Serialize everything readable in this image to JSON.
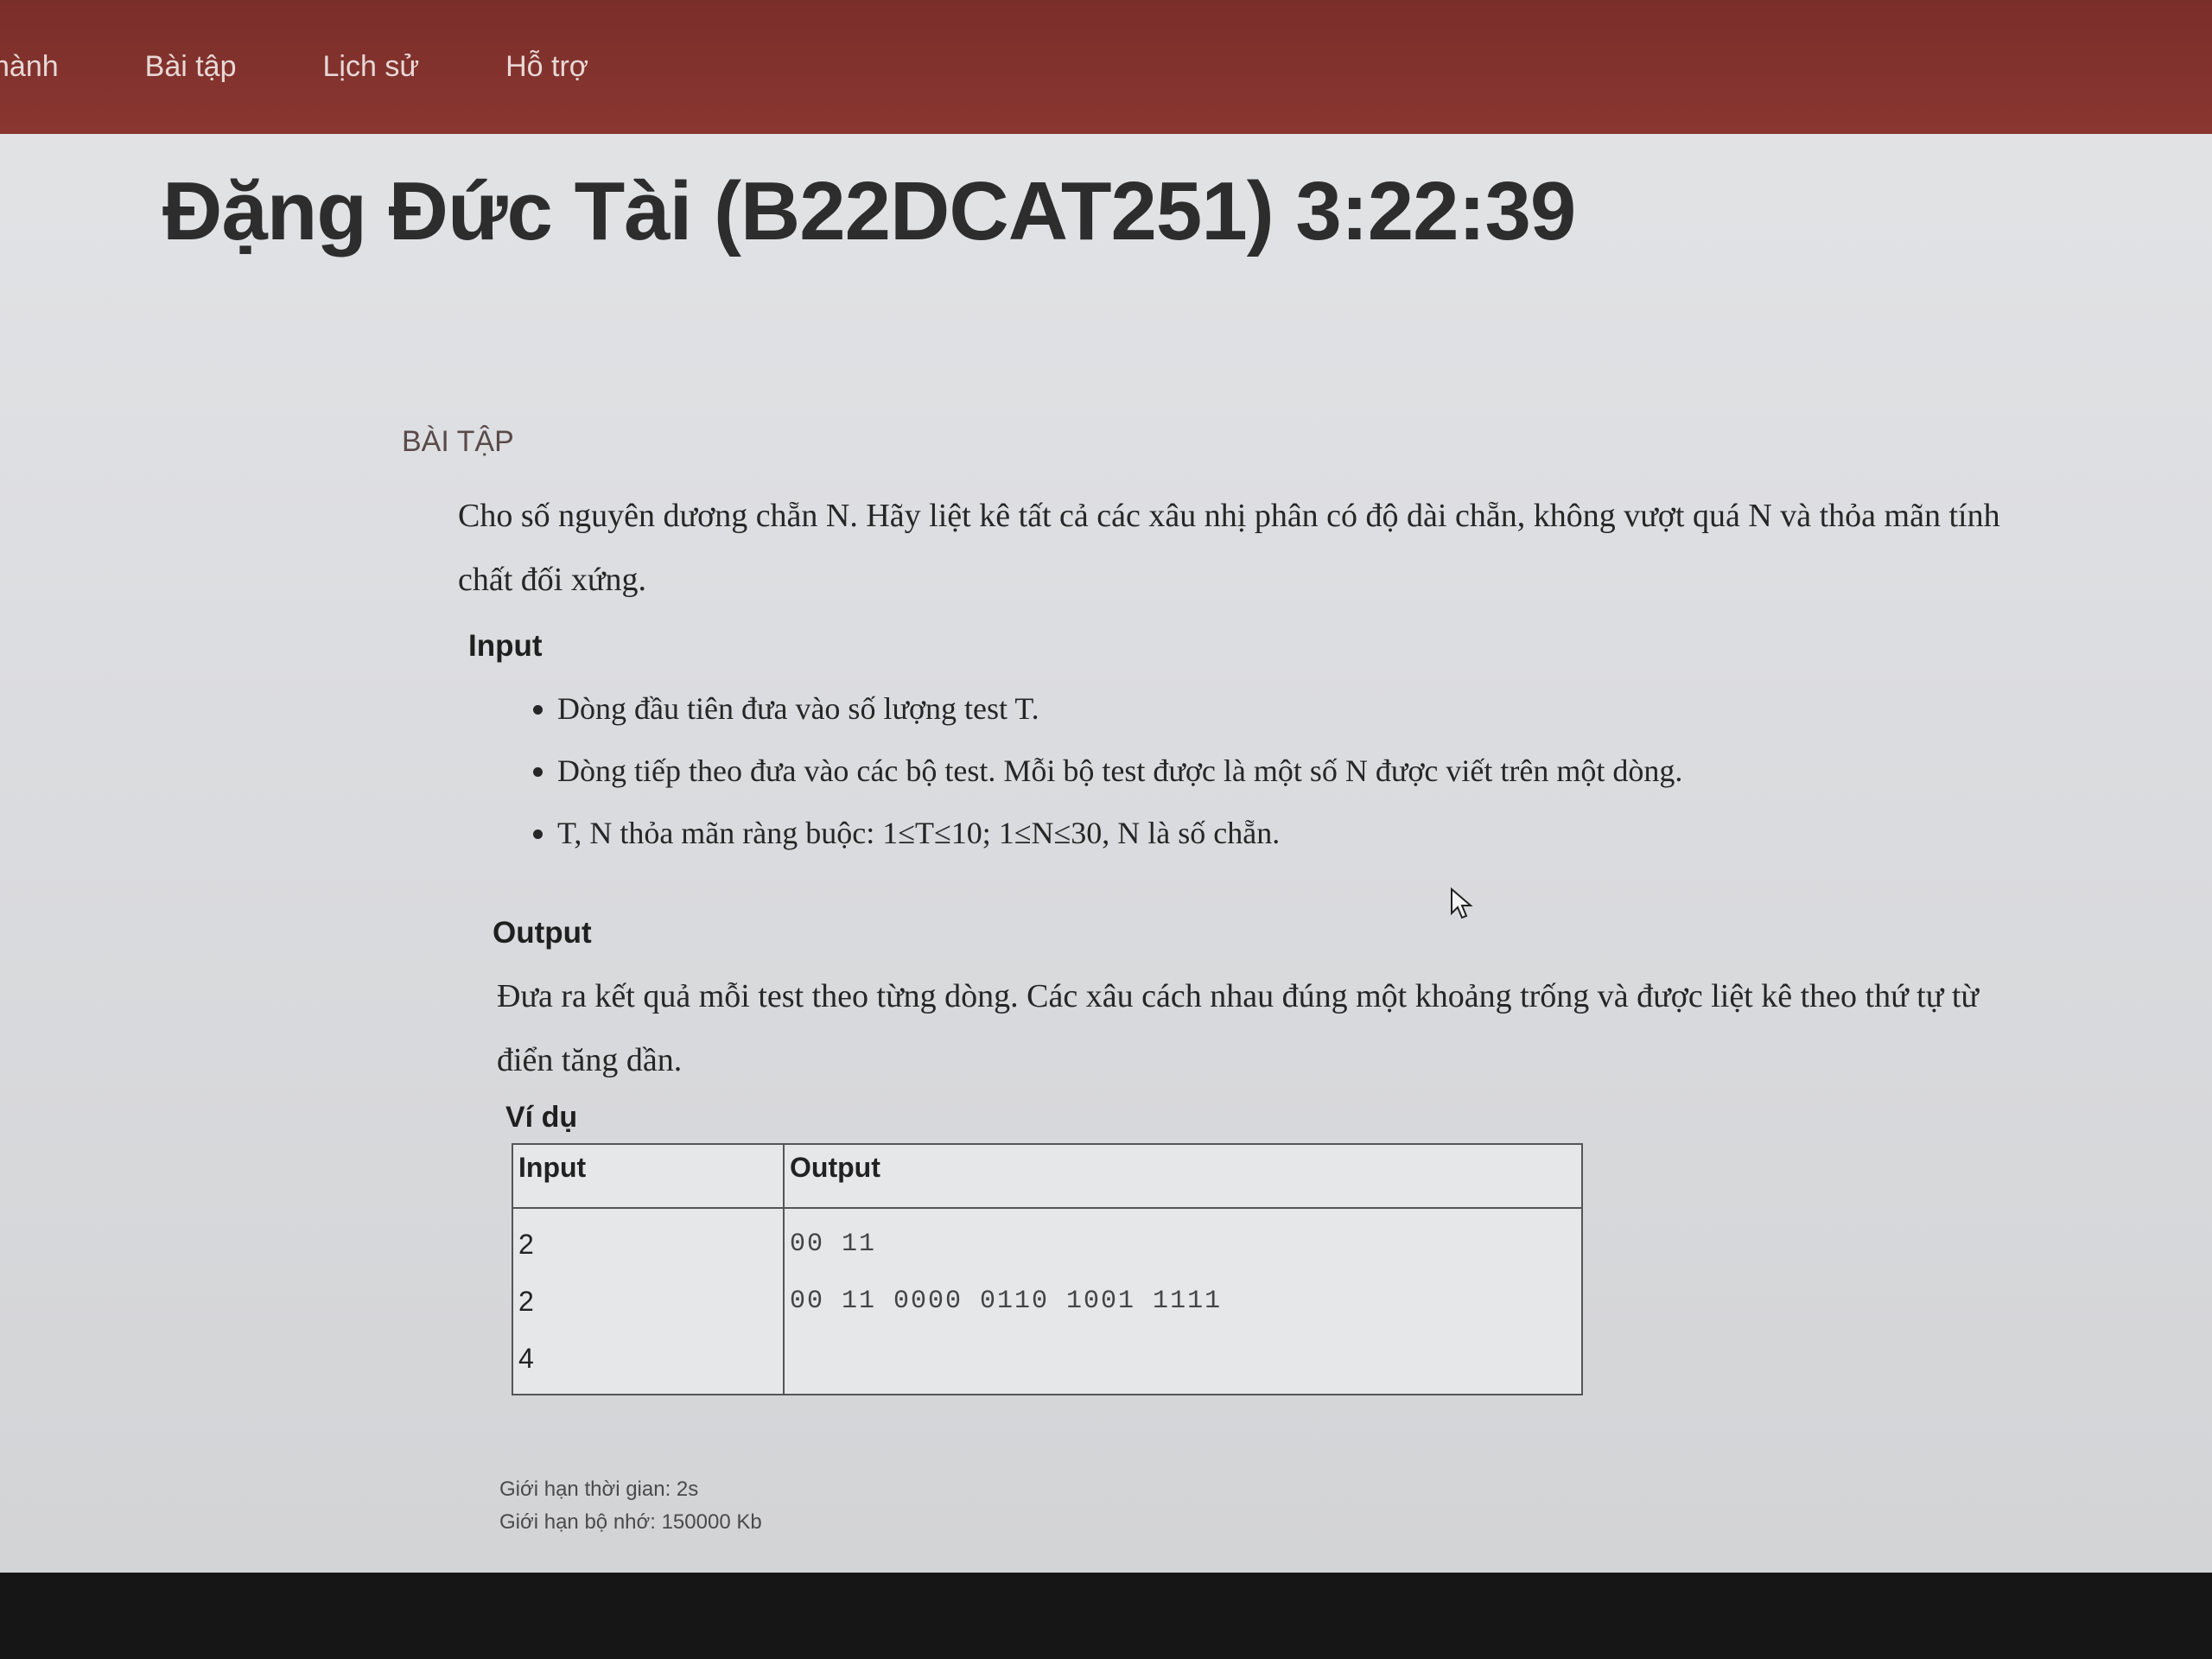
{
  "nav": {
    "items": [
      "hành",
      "Bài tập",
      "Lịch sử",
      "Hỗ trợ"
    ]
  },
  "header": {
    "title": "Đặng Đức Tài (B22DCAT251) 3:22:39"
  },
  "problem": {
    "section_label": "BÀI TẬP",
    "statement": "Cho số nguyên dương chẵn N. Hãy liệt kê tất cả các xâu nhị phân có độ dài chẵn, không vượt quá N và thỏa mãn tính chất đối xứng.",
    "input_heading": "Input",
    "input_items": [
      "Dòng đầu tiên đưa vào số lượng test T.",
      "Dòng tiếp theo đưa vào các bộ test. Mỗi bộ test được là một số N được viết trên một dòng.",
      "T, N thỏa mãn ràng buộc: 1≤T≤10; 1≤N≤30, N là số chẵn."
    ],
    "output_heading": "Output",
    "output_text": "Đưa ra kết quả mỗi test theo từng dòng. Các xâu cách nhau đúng một khoảng trống và được liệt kê theo thứ tự từ điển tăng dần.",
    "example_heading": "Ví dụ",
    "example_table": {
      "headers": [
        "Input",
        "Output"
      ],
      "input_lines": [
        "2",
        "2",
        "4"
      ],
      "output_lines": [
        "00 11",
        "00 11 0000 0110 1001 1111"
      ]
    },
    "time_limit": "Giới hạn thời gian: 2s",
    "memory_limit": "Giới hạn bộ nhớ: 150000 Kb"
  },
  "colors": {
    "navbar": "#7a2e2a",
    "background": "#dcdde0"
  }
}
